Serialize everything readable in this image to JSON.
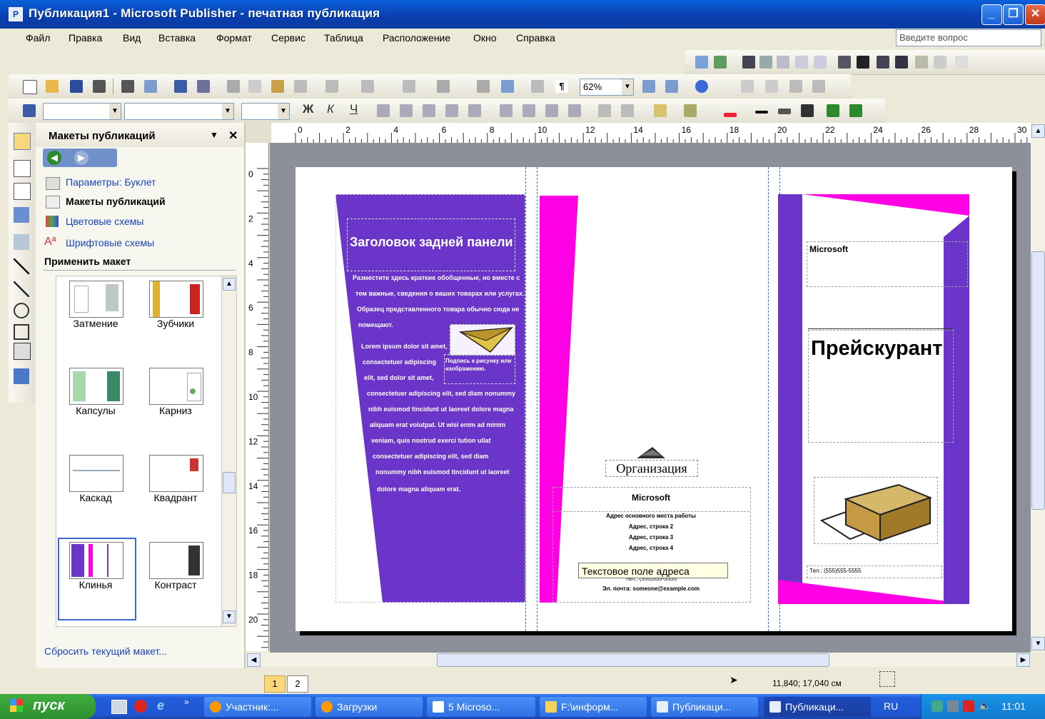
{
  "window": {
    "title": "Публикация1 - Microsoft Publisher - печатная публикация"
  },
  "menu": {
    "items": [
      "Файл",
      "Правка",
      "Вид",
      "Вставка",
      "Формат",
      "Сервис",
      "Таблица",
      "Расположение",
      "Окно",
      "Справка"
    ],
    "ask_placeholder": "Введите вопрос"
  },
  "toolbar": {
    "zoom": "62%"
  },
  "taskpane": {
    "title": "Макеты публикаций",
    "links": [
      "Параметры: Буклет",
      "Макеты публикаций",
      "Цветовые схемы",
      "Шрифтовые схемы"
    ],
    "apply_heading": "Применить макет",
    "layouts": [
      "Затмение",
      "Зубчики",
      "Капсулы",
      "Карниз",
      "Каскад",
      "Квадрант",
      "Клинья",
      "Контраст"
    ],
    "reset_link": "Сбросить текущий макет..."
  },
  "ruler": {
    "top_labels": [
      "0",
      "2",
      "4",
      "6",
      "8",
      "10",
      "12",
      "14",
      "16",
      "18",
      "20",
      "22",
      "24",
      "26",
      "28",
      "30"
    ],
    "left_labels": [
      "0",
      "2",
      "4",
      "6",
      "8",
      "10",
      "12",
      "14",
      "16",
      "18",
      "20"
    ]
  },
  "document": {
    "back_title": "Заголовок задней панели",
    "back_body": [
      "Разместите здесь краткие обобщенные, но вместе с",
      "тем важные, сведения о ваших товарах или услугах.",
      "Образец представленного товара обычно сюда не",
      "помещают.",
      "Lorem ipsum dolor sit amet,",
      "consectetuer adipiscing",
      "elit, sed dolor sit amet,",
      "consectetuer adipiscing elit, sed diam nonummy",
      "nibh euismod tincidunt ut laoreet dolore magna",
      "aliquam erat volutpat. Ut wisi enim ad minim",
      "veniam, quis nostrud exerci tution ullat",
      "consectetuer adipiscing elit, sed diam",
      "nonummy nibh euismod tincidunt ut laoreet",
      "dolore magna aliquam erat."
    ],
    "caption": "Подпись к рисунку или изображению.",
    "org_label": "Организация",
    "mid_company": "Microsoft",
    "addr_lines": [
      "Адрес основного места работы",
      "Адрес, строка 2",
      "Адрес, строка 3",
      "Адрес, строка 4"
    ],
    "tooltip": "Текстовое поле адреса",
    "phone_mid": "Тел.: (555)555-5555",
    "email_mid": "Эл. почта: someone@example.com",
    "cover_company": "Microsoft",
    "cover_title": "Прейскурант",
    "cover_phone": "Тел.: (555)555-5555"
  },
  "status": {
    "pages": [
      "1",
      "2"
    ],
    "coords": "11,840; 17,040 см"
  },
  "taskbar": {
    "start": "пуск",
    "buttons": [
      "Участник:...",
      "Загрузки",
      "5 Microso...",
      "F:\\информ...",
      "Публикаци...",
      "Публикаци..."
    ],
    "lang": "RU",
    "clock": "11:01"
  },
  "colors": {
    "purple": "#6a35c8",
    "magenta": "#ff00e4",
    "titlebar": "#0a3fb0"
  }
}
